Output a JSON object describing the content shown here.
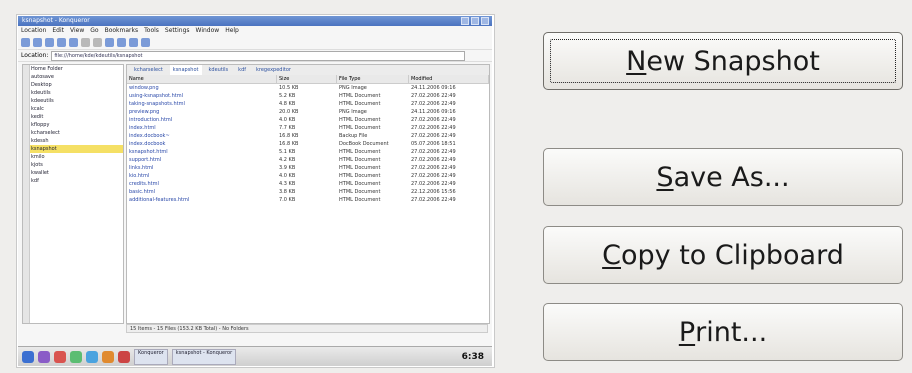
{
  "buttons": [
    {
      "mnemonic": "N",
      "rest": "ew Snapshot"
    },
    {
      "mnemonic": "S",
      "rest": "ave As..."
    },
    {
      "mnemonic": "C",
      "rest": "opy to Clipboard"
    },
    {
      "mnemonic": "P",
      "rest": "rint..."
    }
  ],
  "preview": {
    "window_title": "ksnapshot - Konqueror",
    "menu": [
      "Location",
      "Edit",
      "View",
      "Go",
      "Bookmarks",
      "Tools",
      "Settings",
      "Window",
      "Help"
    ],
    "location_label": "Location:",
    "location_value": "file:///home/kde/kdeutils/ksnapshot",
    "tree": [
      "Home Folder",
      "autosave",
      "Desktop",
      "kdeutils",
      "kdeeutils",
      "kcalc",
      "kedit",
      "kfloppy",
      "kcharselect",
      "kdessh",
      "ksnapshot",
      "kmilo",
      "kjots",
      "kwallet",
      "kdf"
    ],
    "tabs": [
      "kcharselect",
      "ksnapshot",
      "kdeutils",
      "kdf",
      "kregexpeditor"
    ],
    "columns": [
      "Name",
      "Size",
      "File Type",
      "Modified"
    ],
    "files": [
      {
        "name": "window.png",
        "size": "10.5 KB",
        "type": "PNG Image",
        "modified": "24.11.2006 09:16"
      },
      {
        "name": "using-ksnapshot.html",
        "size": "5.2 KB",
        "type": "HTML Document",
        "modified": "27.02.2006 22:49"
      },
      {
        "name": "taking-snapshots.html",
        "size": "4.8 KB",
        "type": "HTML Document",
        "modified": "27.02.2006 22:49"
      },
      {
        "name": "preview.png",
        "size": "20.0 KB",
        "type": "PNG Image",
        "modified": "24.11.2006 09:16"
      },
      {
        "name": "introduction.html",
        "size": "4.0 KB",
        "type": "HTML Document",
        "modified": "27.02.2006 22:49"
      },
      {
        "name": "index.html",
        "size": "7.7 KB",
        "type": "HTML Document",
        "modified": "27.02.2006 22:49"
      },
      {
        "name": "index.docbook~",
        "size": "16.8 KB",
        "type": "Backup File",
        "modified": "27.02.2006 22:49"
      },
      {
        "name": "index.docbook",
        "size": "16.8 KB",
        "type": "DocBook Document",
        "modified": "05.07.2006 18:51"
      },
      {
        "name": "ksnapshot.html",
        "size": "5.1 KB",
        "type": "HTML Document",
        "modified": "27.02.2006 22:49"
      },
      {
        "name": "support.html",
        "size": "4.2 KB",
        "type": "HTML Document",
        "modified": "27.02.2006 22:49"
      },
      {
        "name": "links.html",
        "size": "3.9 KB",
        "type": "HTML Document",
        "modified": "27.02.2006 22:49"
      },
      {
        "name": "kio.html",
        "size": "4.0 KB",
        "type": "HTML Document",
        "modified": "27.02.2006 22:49"
      },
      {
        "name": "credits.html",
        "size": "4.3 KB",
        "type": "HTML Document",
        "modified": "27.02.2006 22:49"
      },
      {
        "name": "basic.html",
        "size": "3.8 KB",
        "type": "HTML Document",
        "modified": "22.12.2006 15:56"
      },
      {
        "name": "additional-features.html",
        "size": "7.0 KB",
        "type": "HTML Document",
        "modified": "27.02.2006 22:49"
      }
    ],
    "status": "15 Items - 15 Files (153.2 KB Total) - No Folders",
    "taskbar": {
      "task1": "Konqueror",
      "task2": "ksnapshot - Konqueror",
      "clock": "6:38"
    }
  }
}
